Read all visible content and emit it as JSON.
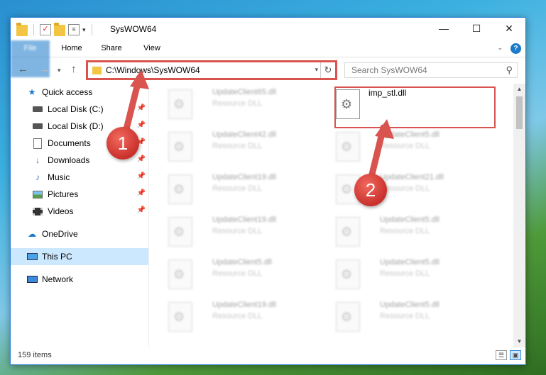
{
  "window": {
    "title": "SysWOW64",
    "controls": {
      "minimize": "—",
      "maximize": "☐",
      "close": "✕"
    }
  },
  "ribbon": {
    "tabs": [
      "File",
      "Home",
      "Share",
      "View"
    ],
    "help": "?"
  },
  "navigation": {
    "address_path": "C:\\Windows\\SysWOW64",
    "search_placeholder": "Search SysWOW64"
  },
  "sidebar": {
    "items": [
      {
        "label": "Quick access",
        "icon": "star-icon",
        "pinned": false
      },
      {
        "label": "Local Disk (C:)",
        "icon": "disk-icon",
        "pinned": true
      },
      {
        "label": "Local Disk (D:)",
        "icon": "disk-icon",
        "pinned": true
      },
      {
        "label": "Documents",
        "icon": "document-icon",
        "pinned": true
      },
      {
        "label": "Downloads",
        "icon": "download-icon",
        "pinned": true
      },
      {
        "label": "Music",
        "icon": "music-icon",
        "pinned": true
      },
      {
        "label": "Pictures",
        "icon": "pictures-icon",
        "pinned": true
      },
      {
        "label": "Videos",
        "icon": "videos-icon",
        "pinned": true
      },
      {
        "label": "OneDrive",
        "icon": "cloud-icon",
        "pinned": false
      },
      {
        "label": "This PC",
        "icon": "computer-icon",
        "pinned": false,
        "selected": true
      },
      {
        "label": "Network",
        "icon": "network-icon",
        "pinned": false
      }
    ]
  },
  "files": {
    "left_column": [
      {
        "name": "UpdateClient65.dll",
        "type": "Resource DLL"
      },
      {
        "name": "UpdateClient42.dll",
        "type": "Resource DLL"
      },
      {
        "name": "UpdateClient19.dll",
        "type": "Resource DLL"
      },
      {
        "name": "UpdateClient19.dll",
        "type": "Resource DLL"
      },
      {
        "name": "UpdateClient5.dll",
        "type": "Resource DLL"
      },
      {
        "name": "UpdateClient19.dll",
        "type": "Resource DLL"
      }
    ],
    "right_column": [
      {
        "name": "imp_stl.dll",
        "type": ""
      },
      {
        "name": "UpdateClient5.dll",
        "type": "Resource DLL"
      },
      {
        "name": "UpdateClient21.dll",
        "type": "Resource DLL"
      },
      {
        "name": "UpdateClient5.dll",
        "type": "Resource DLL"
      },
      {
        "name": "UpdateClient5.dll",
        "type": "Resource DLL"
      },
      {
        "name": "UpdateClient5.dll",
        "type": "Resource DLL"
      }
    ]
  },
  "status": {
    "item_count": "159 items"
  },
  "annotations": {
    "marker1": "1",
    "marker2": "2",
    "color": "#d9534f"
  }
}
